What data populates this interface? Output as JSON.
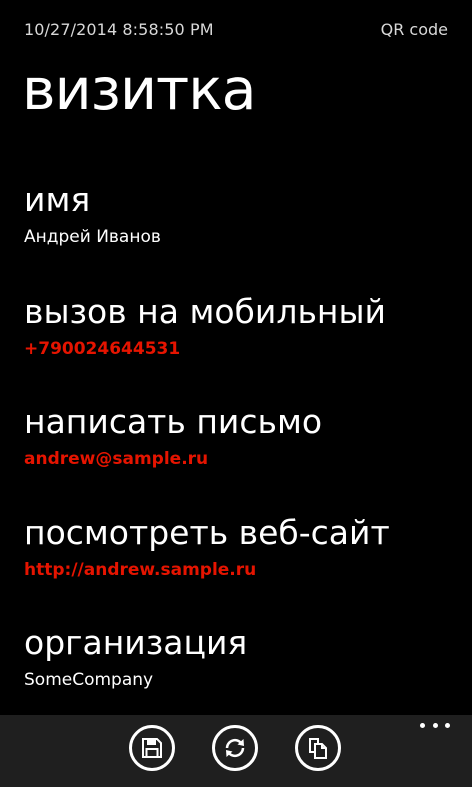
{
  "status_bar": {
    "datetime": "10/27/2014 8:58:50 PM",
    "qr_code_label": "QR code"
  },
  "page": {
    "title": "визитка"
  },
  "items": [
    {
      "label": "имя",
      "value": "Андрей Иванов"
    },
    {
      "label": "вызов на мобильный",
      "value": "+790024644531"
    },
    {
      "label": "написать письмо",
      "value": "andrew@sample.ru"
    },
    {
      "label": "посмотреть веб-сайт",
      "value": "http://andrew.sample.ru"
    },
    {
      "label": "организация",
      "value": "SomeCompany"
    }
  ],
  "app_bar": {
    "buttons": [
      {
        "icon": "save-icon"
      },
      {
        "icon": "sync-icon"
      },
      {
        "icon": "copy-icon"
      }
    ],
    "more_icon": "ellipsis-icon",
    "background": "#1f1f1f"
  },
  "colors": {
    "background": "#000000",
    "text": "#ffffff",
    "accent": "#e51400"
  }
}
